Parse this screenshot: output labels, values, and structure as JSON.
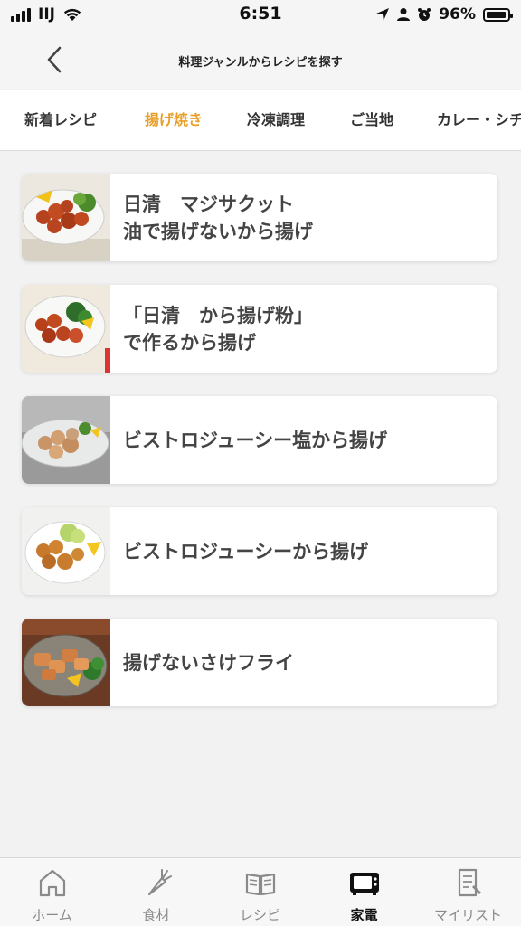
{
  "status_bar": {
    "carrier": "IIJ",
    "time": "6:51",
    "battery": "96%",
    "battery_level": 0.96
  },
  "header": {
    "title": "料理ジャンルからレシピを探す"
  },
  "tabs": [
    {
      "label": "新着レシピ",
      "active": false
    },
    {
      "label": "揚げ焼き",
      "active": true
    },
    {
      "label": "冷凍調理",
      "active": false
    },
    {
      "label": "ご当地",
      "active": false
    },
    {
      "label": "カレー・シチ",
      "active": false
    }
  ],
  "recipes": [
    {
      "title": "日清　マジサクット\n油で揚げないから揚げ",
      "thumb": "karaage-lemon-lettuce"
    },
    {
      "title": "「日清　から揚げ粉」\nで作るから揚げ",
      "thumb": "karaage-herbs"
    },
    {
      "title": "ビストロジューシー塩から揚げ",
      "thumb": "shio-karaage"
    },
    {
      "title": "ビストロジューシーから揚げ",
      "thumb": "karaage-cabbage"
    },
    {
      "title": "揚げないさけフライ",
      "thumb": "salmon-fry-broccoli"
    }
  ],
  "bottom_nav": [
    {
      "label": "ホーム",
      "icon": "home-icon",
      "active": false
    },
    {
      "label": "食材",
      "icon": "carrot-icon",
      "active": false
    },
    {
      "label": "レシピ",
      "icon": "book-icon",
      "active": false
    },
    {
      "label": "家電",
      "icon": "microwave-icon",
      "active": true
    },
    {
      "label": "マイリスト",
      "icon": "mylist-icon",
      "active": false
    }
  ],
  "colors": {
    "accent": "#e8a02c",
    "background": "#f2f2f2",
    "card": "#ffffff",
    "text": "#444444"
  }
}
